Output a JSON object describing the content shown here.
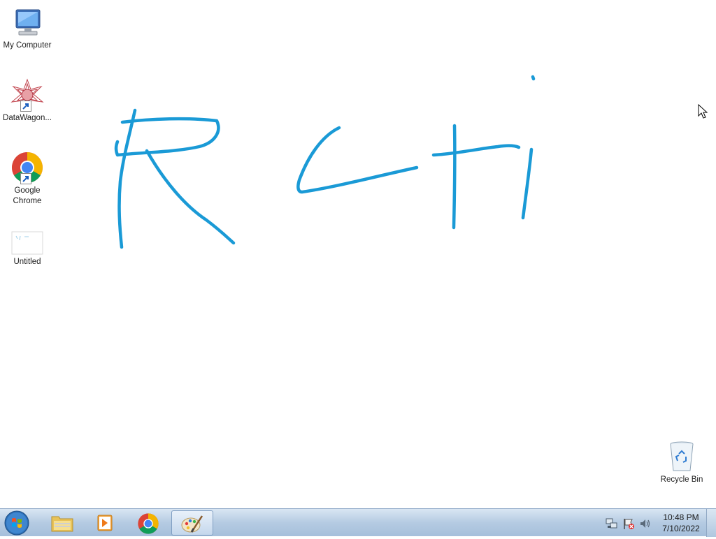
{
  "desktop": {
    "icons": [
      {
        "label": "My Computer",
        "icon": "computer-icon"
      },
      {
        "label": "DataWagon...",
        "icon": "datawagon-icon"
      },
      {
        "label": "Google Chrome",
        "icon": "chrome-icon"
      },
      {
        "label": "Untitled",
        "icon": "image-file-icon"
      },
      {
        "label": "Recycle Bin",
        "icon": "recycle-bin-icon"
      }
    ],
    "drawing_color": "#1a9ad6"
  },
  "taskbar": {
    "apps": [
      {
        "name": "Windows Explorer",
        "icon": "folder-icon"
      },
      {
        "name": "Windows Media Player",
        "icon": "media-player-icon"
      },
      {
        "name": "Google Chrome",
        "icon": "chrome-icon"
      },
      {
        "name": "Paint",
        "icon": "paint-icon",
        "active": true
      }
    ],
    "clock": {
      "time": "10:48 PM",
      "date": "7/10/2022"
    }
  }
}
